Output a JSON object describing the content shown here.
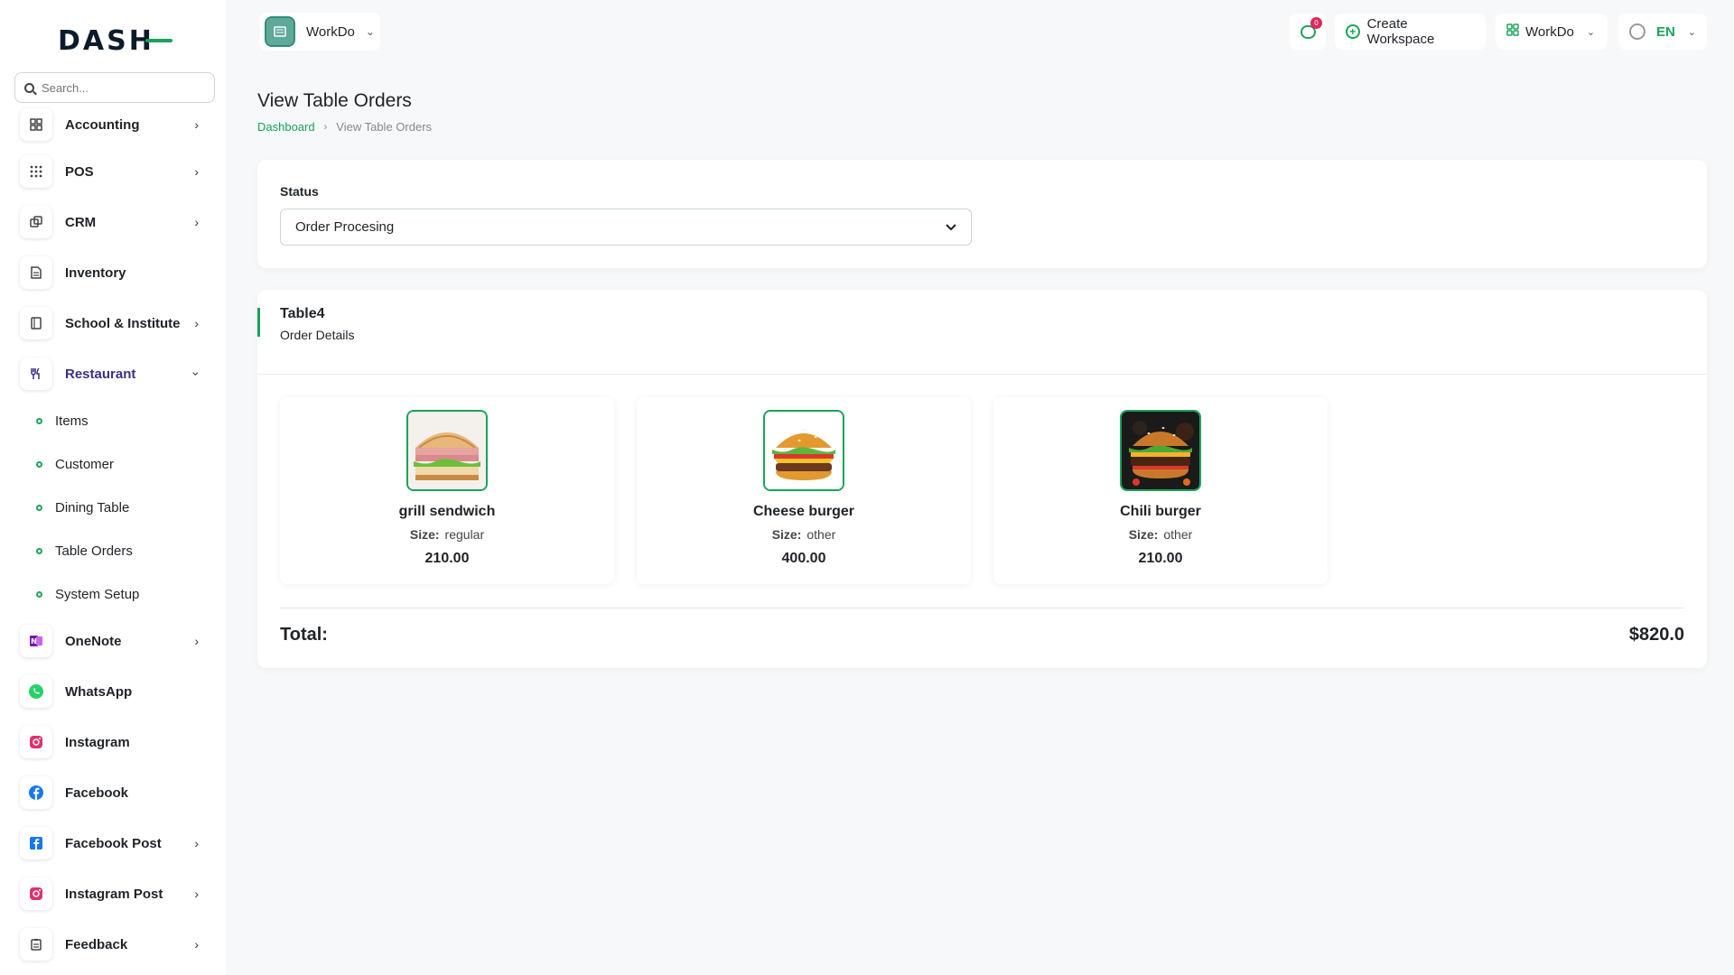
{
  "brand": {
    "logo_text": "DASH"
  },
  "search": {
    "placeholder": "Search..."
  },
  "sidebar": {
    "items": [
      {
        "label": "Accounting",
        "icon": "grid-icon",
        "chevron": true
      },
      {
        "label": "POS",
        "icon": "dots-grid-icon",
        "chevron": true
      },
      {
        "label": "CRM",
        "icon": "layers-icon",
        "chevron": true
      },
      {
        "label": "Inventory",
        "icon": "document-icon",
        "chevron": false
      },
      {
        "label": "School & Institute",
        "icon": "book-icon",
        "chevron": true
      },
      {
        "label": "Restaurant",
        "icon": "utensils-icon",
        "chevron": true,
        "expanded": true
      }
    ],
    "restaurant_sub": [
      "Items",
      "Customer",
      "Dining Table",
      "Table Orders",
      "System Setup"
    ],
    "items_after": [
      {
        "label": "OneNote",
        "icon": "onenote-icon",
        "chevron": true,
        "color": "#7719aa"
      },
      {
        "label": "WhatsApp",
        "icon": "whatsapp-icon",
        "chevron": false,
        "color": "#25d366"
      },
      {
        "label": "Instagram",
        "icon": "instagram-icon",
        "chevron": false,
        "color": "#e1306c"
      },
      {
        "label": "Facebook",
        "icon": "facebook-icon",
        "chevron": false,
        "color": "#1877f2"
      },
      {
        "label": "Facebook Post",
        "icon": "facebook-post-icon",
        "chevron": true,
        "color": "#1877f2"
      },
      {
        "label": "Instagram Post",
        "icon": "instagram-post-icon",
        "chevron": true,
        "color": "#e1306c"
      },
      {
        "label": "Feedback",
        "icon": "clipboard-icon",
        "chevron": true
      }
    ]
  },
  "header": {
    "workspace": "WorkDo",
    "messages_badge": "0",
    "create_workspace": "Create Workspace",
    "workdo_menu": "WorkDo",
    "language": "EN"
  },
  "page": {
    "title": "View Table Orders",
    "breadcrumb_home": "Dashboard",
    "breadcrumb_current": "View Table Orders"
  },
  "status": {
    "label": "Status",
    "value": "Order Procesing"
  },
  "order": {
    "table": "Table4",
    "subtitle": "Order Details",
    "items": [
      {
        "name": "grill sendwich",
        "size_label": "Size:",
        "size": "regular",
        "price": "210.00",
        "image": "sandwich-image"
      },
      {
        "name": "Cheese burger",
        "size_label": "Size:",
        "size": "other",
        "price": "400.00",
        "image": "cheese-burger-image"
      },
      {
        "name": "Chili burger",
        "size_label": "Size:",
        "size": "other",
        "price": "210.00",
        "image": "chili-burger-image"
      }
    ],
    "total_label": "Total:",
    "total_value": "$820.0"
  },
  "colors": {
    "accent": "#1aa35a",
    "active_nav": "#3b2f86"
  }
}
